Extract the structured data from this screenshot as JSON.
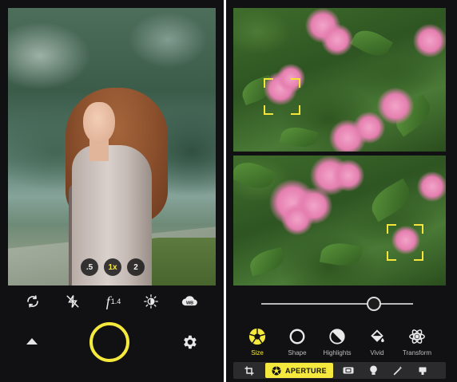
{
  "colors": {
    "accent": "#f4e93c",
    "panel_bg": "#111113",
    "icon": "#e9e9e9",
    "label": "#bdbdbd"
  },
  "left": {
    "zoom": {
      "half": ".5",
      "one": "1x",
      "two": "2"
    },
    "toolbar": {
      "icons": [
        "rotate-camera-icon",
        "flash-off-icon",
        "aperture-f-icon",
        "exposure-icon",
        "white-balance-icon"
      ],
      "f_label": "f",
      "f_value": "1.4",
      "wb_label": "WB"
    },
    "controls": {
      "shutter": "shutter-button",
      "expand": "up-arrow-icon",
      "settings": "gear-icon"
    }
  },
  "right": {
    "slider": {
      "value": 0.74
    },
    "tools": [
      {
        "label": "Size",
        "icon": "aperture-icon"
      },
      {
        "label": "Shape",
        "icon": "circle-icon"
      },
      {
        "label": "Highlights",
        "icon": "highlights-icon"
      },
      {
        "label": "Vivid",
        "icon": "paint-bucket-icon"
      },
      {
        "label": "Transform",
        "icon": "atom-icon"
      }
    ],
    "bottom_bar": {
      "active_tab": "APERTURE",
      "icons": [
        "crop-icon",
        "aperture-icon",
        "film-icon",
        "bulb-icon",
        "magic-wand-icon",
        "stamp-icon"
      ]
    }
  }
}
